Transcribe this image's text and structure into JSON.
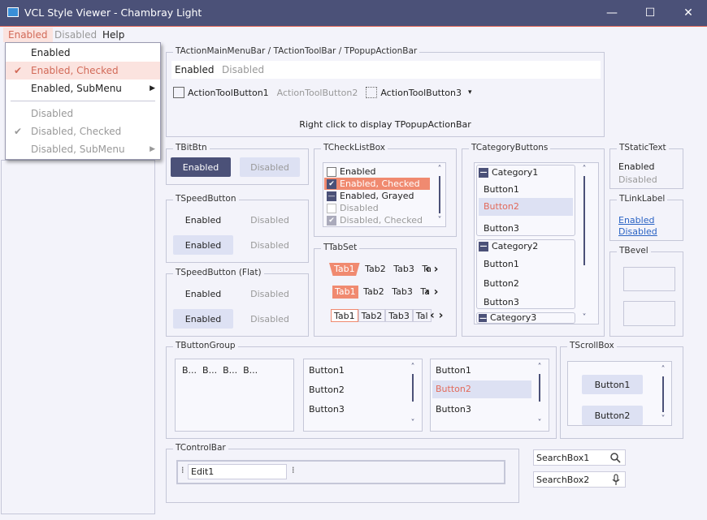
{
  "window": {
    "title": "VCL Style Viewer - Chambray Light",
    "minimize": "—",
    "maximize": "☐",
    "close": "✕"
  },
  "menubar": {
    "items": [
      "Enabled",
      "Disabled",
      "Help"
    ]
  },
  "popup_menu": {
    "items": [
      {
        "label": "Enabled",
        "check": "",
        "arrow": ""
      },
      {
        "label": "Enabled, Checked",
        "check": "✔",
        "arrow": ""
      },
      {
        "label": "Enabled, SubMenu",
        "check": "",
        "arrow": "▶"
      },
      {
        "label": "Disabled",
        "check": "",
        "arrow": ""
      },
      {
        "label": "Disabled, Checked",
        "check": "✔",
        "arrow": ""
      },
      {
        "label": "Disabled, SubMenu",
        "check": "",
        "arrow": "▶"
      }
    ]
  },
  "actionbar": {
    "title": "TActionMainMenuBar / TActionToolBar / TPopupActionBar",
    "menu_enabled": "Enabled",
    "menu_disabled": "Disabled",
    "tool1": "ActionToolButton1",
    "tool2": "ActionToolButton2",
    "tool3": "ActionToolButton3",
    "tool3_arrow": "▾",
    "hint": "Right click to display TPopupActionBar"
  },
  "bitbtn": {
    "title": "TBitBtn",
    "enabled": "Enabled",
    "disabled": "Disabled"
  },
  "speedbutton": {
    "title": "TSpeedButton",
    "e1": "Enabled",
    "d1": "Disabled",
    "e2": "Enabled",
    "d2": "Disabled"
  },
  "speedflat": {
    "title": "TSpeedButton (Flat)",
    "e1": "Enabled",
    "d1": "Disabled",
    "e2": "Enabled",
    "d2": "Disabled"
  },
  "checklist": {
    "title": "TCheckListBox",
    "items": [
      "Enabled",
      "Enabled, Checked",
      "Enabled, Grayed",
      "Disabled",
      "Disabled, Checked"
    ],
    "marks": [
      "",
      "✔",
      "—",
      "",
      "✔"
    ],
    "up": "˄",
    "down": "˅"
  },
  "tabset": {
    "title": "TTabSet",
    "tabs": [
      "Tab1",
      "Tab2",
      "Tab3",
      "Ta"
    ],
    "tabs3": [
      "Tab1",
      "Tab2",
      "Tab3",
      "Tal"
    ],
    "prev": "‹",
    "next": "›"
  },
  "category": {
    "title": "TCategoryButtons",
    "collapse": "—",
    "cat1": "Category1",
    "cat2": "Category2",
    "cat3": "Category3",
    "b1": "Button1",
    "b2": "Button2",
    "b3": "Button3",
    "up": "˄",
    "down": "˅"
  },
  "statictext": {
    "title": "TStaticText",
    "enabled": "Enabled",
    "disabled": "Disabled"
  },
  "linklabel": {
    "title": "TLinkLabel",
    "enabled": "Enabled",
    "disabled": "Disabled"
  },
  "bevel": {
    "title": "TBevel"
  },
  "buttongroup": {
    "title": "TButtonGroup",
    "items": [
      "B...",
      "B...",
      "B...",
      "B..."
    ],
    "list1": [
      "Button1",
      "Button2",
      "Button3"
    ],
    "list2": [
      "Button1",
      "Button2",
      "Button3"
    ],
    "up": "˄",
    "down": "˅"
  },
  "scrollbox": {
    "title": "TScrollBox",
    "b1": "Button1",
    "b2": "Button2",
    "up": "˄",
    "down": "˅"
  },
  "controlbar": {
    "title": "TControlBar",
    "edit": "Edit1"
  },
  "searchbox": {
    "s1": "SearchBox1",
    "s2": "SearchBox2"
  },
  "colors": {
    "accent": "#4b5178",
    "highlight": "#f08a70",
    "menu_hover": "#fbe3df"
  }
}
